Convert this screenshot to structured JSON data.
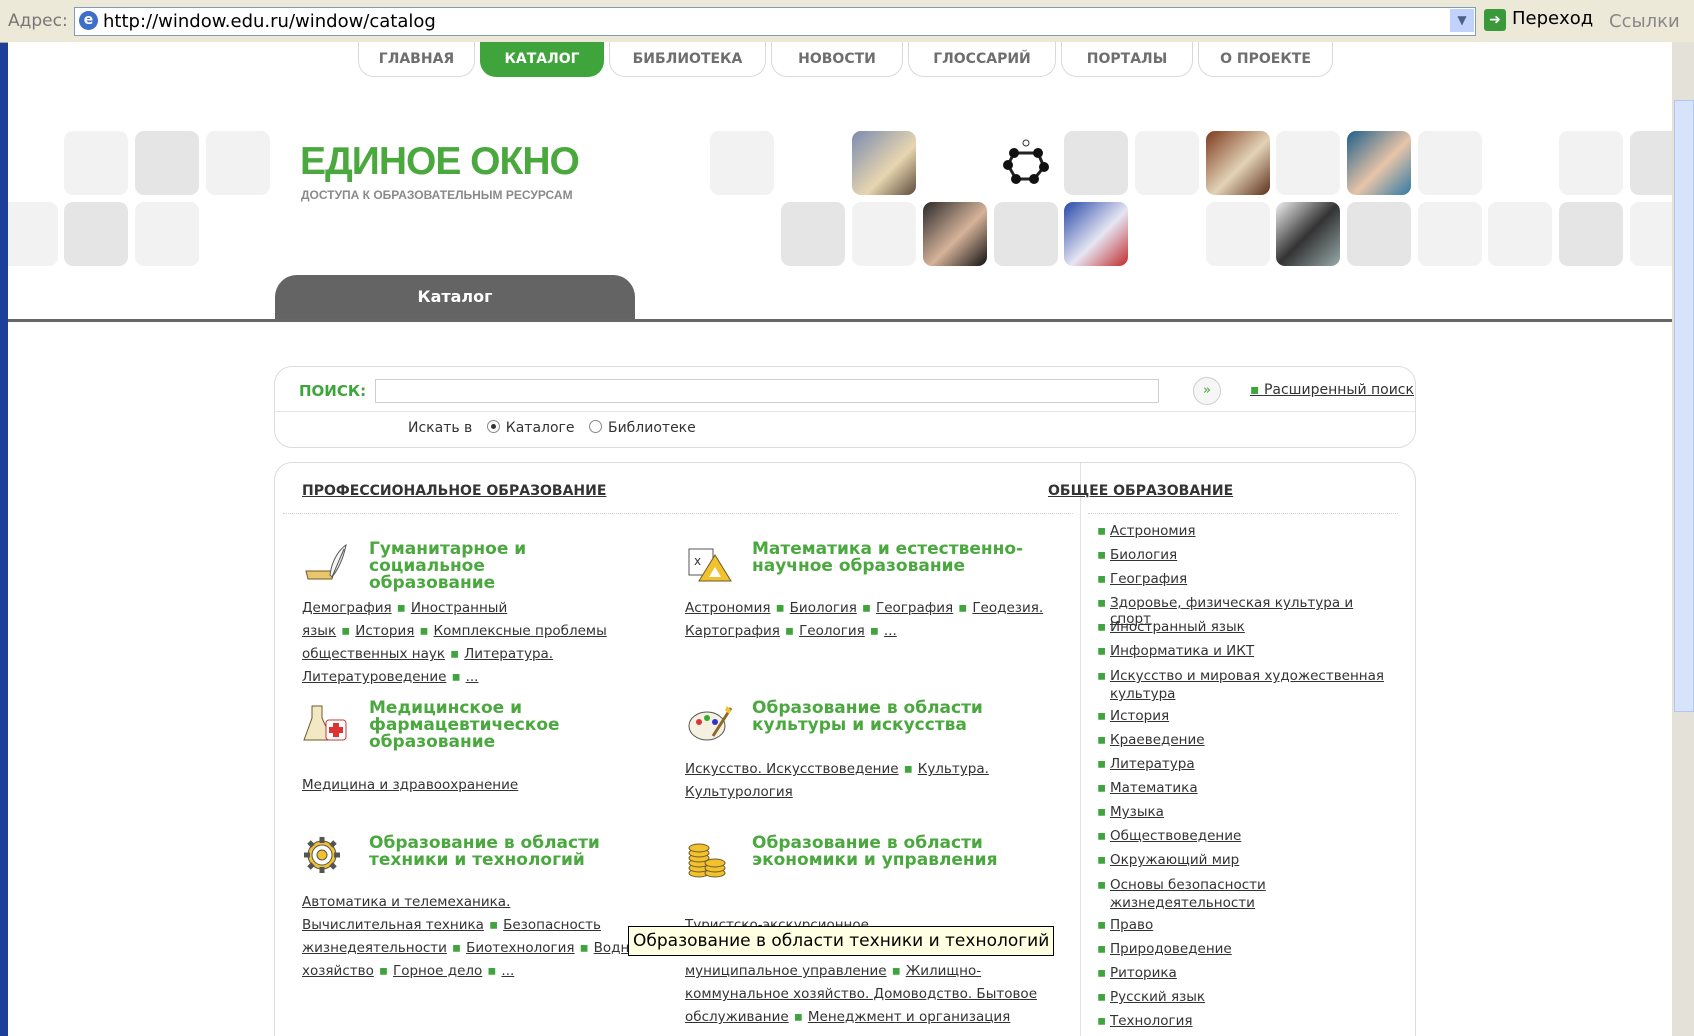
{
  "browser": {
    "address_label": "Адрес:",
    "url": "http://window.edu.ru/window/catalog",
    "go_label": "Переход",
    "links_label": "Ссылки"
  },
  "nav": {
    "tabs": [
      "ГЛАВНАЯ",
      "КАТАЛОГ",
      "БИБЛИОТЕКА",
      "НОВОСТИ",
      "ГЛОССАРИЙ",
      "ПОРТАЛЫ",
      "О ПРОЕКТЕ"
    ],
    "active_tab": "КАТАЛОГ"
  },
  "logo": {
    "title": "ЕДИНОЕ ОКНО",
    "subtitle": "ДОСТУПА К ОБРАЗОВАТЕЛЬНЫМ РЕСУРСАМ"
  },
  "catalog_tab": "Каталог",
  "search": {
    "label": "ПОИСК:",
    "value": "",
    "advanced_link": "Расширенный поиск",
    "search_in_label": "Искать в",
    "option_catalog": "Каталоге",
    "option_library": "Библиотеке",
    "selected": "Каталоге"
  },
  "professional": {
    "title": "ПРОФЕССИОНАЛЬНОЕ ОБРАЗОВАНИЕ",
    "categories": [
      {
        "icon": "pen-inkwell-icon",
        "title_lines": [
          "Гуманитарное и социальное",
          "образование"
        ],
        "links": [
          "Демография",
          "Иностранный язык",
          "История",
          "Комплексные проблемы общественных наук",
          "Литература. Литературоведение",
          "..."
        ]
      },
      {
        "icon": "ruler-triangle-icon",
        "title_lines": [
          "Математика и естественно-",
          "научное образование"
        ],
        "links": [
          "Астрономия",
          "Биология",
          "География",
          "Геодезия. Картография",
          "Геология",
          "..."
        ]
      },
      {
        "icon": "medical-flask-cross-icon",
        "title_lines": [
          "Медицинское и",
          "фармацевтическое",
          "образование"
        ],
        "links": [
          "Медицина и здравоохранение"
        ]
      },
      {
        "icon": "palette-brush-icon",
        "title_lines": [
          "Образование в области",
          "культуры и искусства"
        ],
        "links": [
          "Искусство. Искусствоведение",
          "Культура. Культурология"
        ]
      },
      {
        "icon": "gear-icon",
        "title_lines": [
          "Образование в области",
          "техники и технологий"
        ],
        "links": [
          "Автоматика и телемеханика. Вычислительная техника",
          "Безопасность жизнедеятельности",
          "Биотехнология",
          "Водное хозяйство",
          "Горное дело",
          "..."
        ]
      },
      {
        "icon": "coins-stack-icon",
        "title_lines": [
          "Образование в области",
          "экономики и управления"
        ],
        "links": [
          "Туристско-экскурсионное обслуживание",
          "Государственное и муниципальное управление",
          "Жилищно-коммунальное хозяйство. Домоводство. Бытовое обслуживание",
          "Менеджмент и организация управления",
          "..."
        ]
      }
    ]
  },
  "general": {
    "title": "ОБЩЕЕ ОБРАЗОВАНИЕ",
    "items": [
      "Астрономия",
      "Биология",
      "География",
      "Здоровье, физическая культура и спорт",
      "Иностранный язык",
      "Информатика и ИКТ",
      "Искусство и мировая художественная культура",
      "История",
      "Краеведение",
      "Литература",
      "Математика",
      "Музыка",
      "Обществоведение",
      "Окружающий мир",
      "Основы безопасности жизнедеятельности",
      "Право",
      "Природоведение",
      "Риторика",
      "Русский язык",
      "Технология"
    ]
  },
  "tooltip": "Образование в области техники и технологий",
  "colors": {
    "accent": "#3ea43b",
    "logo_green": "#4aa83f",
    "catalog_tab": "#646464",
    "desktop_blue": "#1c3f9a"
  }
}
